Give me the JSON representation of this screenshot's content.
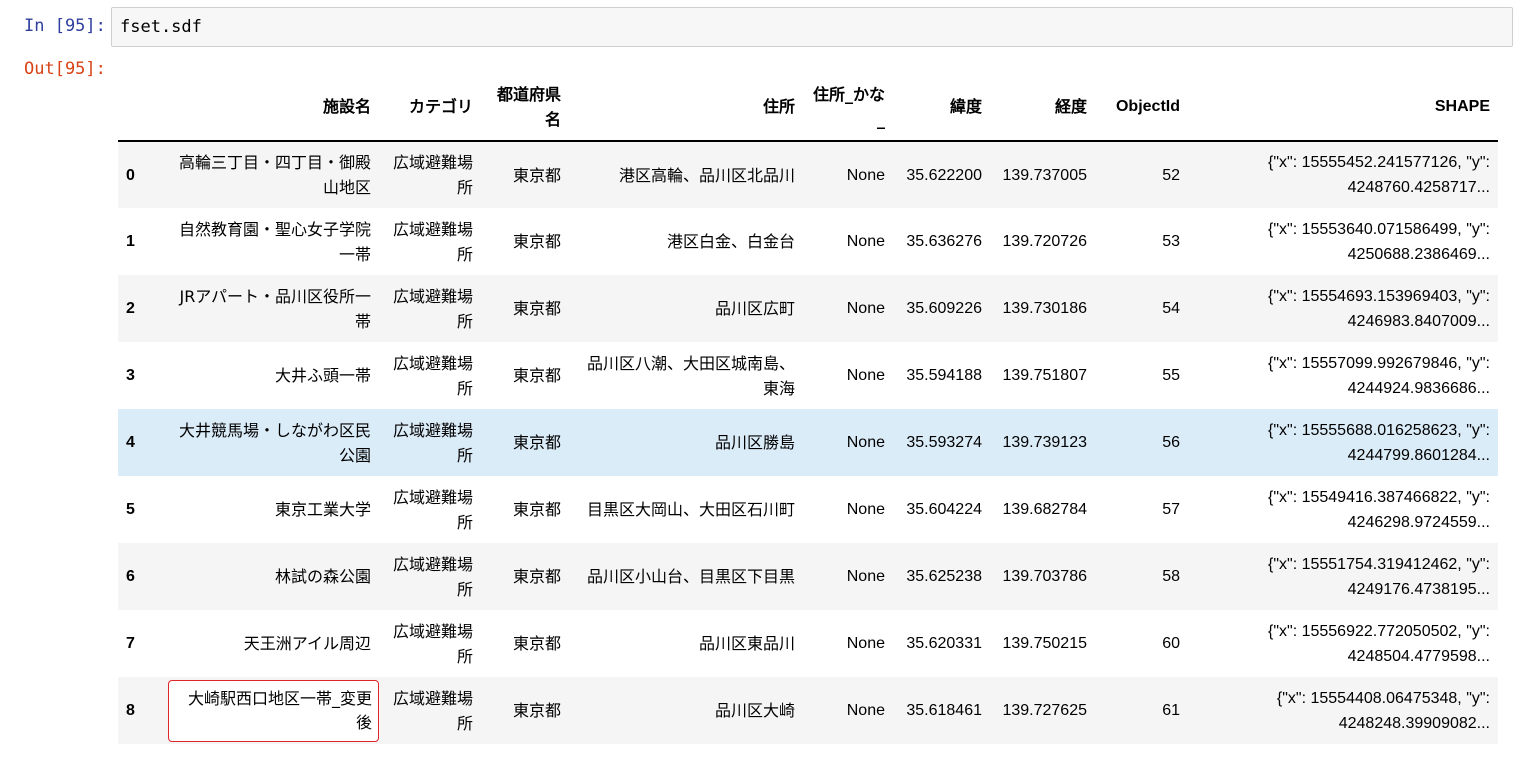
{
  "input_prompt": "In [95]:",
  "output_prompt": "Out[95]:",
  "code": "fset.sdf",
  "table": {
    "columns": [
      "",
      "施設名",
      "カテゴリ",
      "都道府県名",
      "住所",
      "住所_かな_",
      "緯度",
      "経度",
      "ObjectId",
      "SHAPE"
    ],
    "rows": [
      {
        "index": "0",
        "name": "高輪三丁目・四丁目・御殿山地区",
        "category": "広域避難場所",
        "pref": "東京都",
        "address": "港区高輪、品川区北品川",
        "kana": "None",
        "lat": "35.622200",
        "lon": "139.737005",
        "oid": "52",
        "shape": "{\"x\": 15555452.241577126, \"y\": 4248760.4258717..."
      },
      {
        "index": "1",
        "name": "自然教育園・聖心女子学院一帯",
        "category": "広域避難場所",
        "pref": "東京都",
        "address": "港区白金、白金台",
        "kana": "None",
        "lat": "35.636276",
        "lon": "139.720726",
        "oid": "53",
        "shape": "{\"x\": 15553640.071586499, \"y\": 4250688.2386469..."
      },
      {
        "index": "2",
        "name": "JRアパート・品川区役所一帯",
        "category": "広域避難場所",
        "pref": "東京都",
        "address": "品川区広町",
        "kana": "None",
        "lat": "35.609226",
        "lon": "139.730186",
        "oid": "54",
        "shape": "{\"x\": 15554693.153969403, \"y\": 4246983.8407009..."
      },
      {
        "index": "3",
        "name": "大井ふ頭一帯",
        "category": "広域避難場所",
        "pref": "東京都",
        "address": "品川区八潮、大田区城南島、東海",
        "kana": "None",
        "lat": "35.594188",
        "lon": "139.751807",
        "oid": "55",
        "shape": "{\"x\": 15557099.992679846, \"y\": 4244924.9836686..."
      },
      {
        "index": "4",
        "name": "大井競馬場・しながわ区民公園",
        "category": "広域避難場所",
        "pref": "東京都",
        "address": "品川区勝島",
        "kana": "None",
        "lat": "35.593274",
        "lon": "139.739123",
        "oid": "56",
        "shape": "{\"x\": 15555688.016258623, \"y\": 4244799.8601284..."
      },
      {
        "index": "5",
        "name": "東京工業大学",
        "category": "広域避難場所",
        "pref": "東京都",
        "address": "目黒区大岡山、大田区石川町",
        "kana": "None",
        "lat": "35.604224",
        "lon": "139.682784",
        "oid": "57",
        "shape": "{\"x\": 15549416.387466822, \"y\": 4246298.9724559..."
      },
      {
        "index": "6",
        "name": "林試の森公園",
        "category": "広域避難場所",
        "pref": "東京都",
        "address": "品川区小山台、目黒区下目黒",
        "kana": "None",
        "lat": "35.625238",
        "lon": "139.703786",
        "oid": "58",
        "shape": "{\"x\": 15551754.319412462, \"y\": 4249176.4738195..."
      },
      {
        "index": "7",
        "name": "天王洲アイル周辺",
        "category": "広域避難場所",
        "pref": "東京都",
        "address": "品川区東品川",
        "kana": "None",
        "lat": "35.620331",
        "lon": "139.750215",
        "oid": "60",
        "shape": "{\"x\": 15556922.772050502, \"y\": 4248504.4779598..."
      },
      {
        "index": "8",
        "name": "大崎駅西口地区一帯_変更後",
        "category": "広域避難場所",
        "pref": "東京都",
        "address": "品川区大崎",
        "kana": "None",
        "lat": "35.618461",
        "lon": "139.727625",
        "oid": "61",
        "shape": "{\"x\": 15554408.06475348, \"y\": 4248248.39909082..."
      }
    ]
  },
  "colors": {
    "input_prompt": "#303f9f",
    "output_prompt": "#d84315",
    "highlight_row": "#dbecf9",
    "highlight_border": "#e0242b"
  }
}
